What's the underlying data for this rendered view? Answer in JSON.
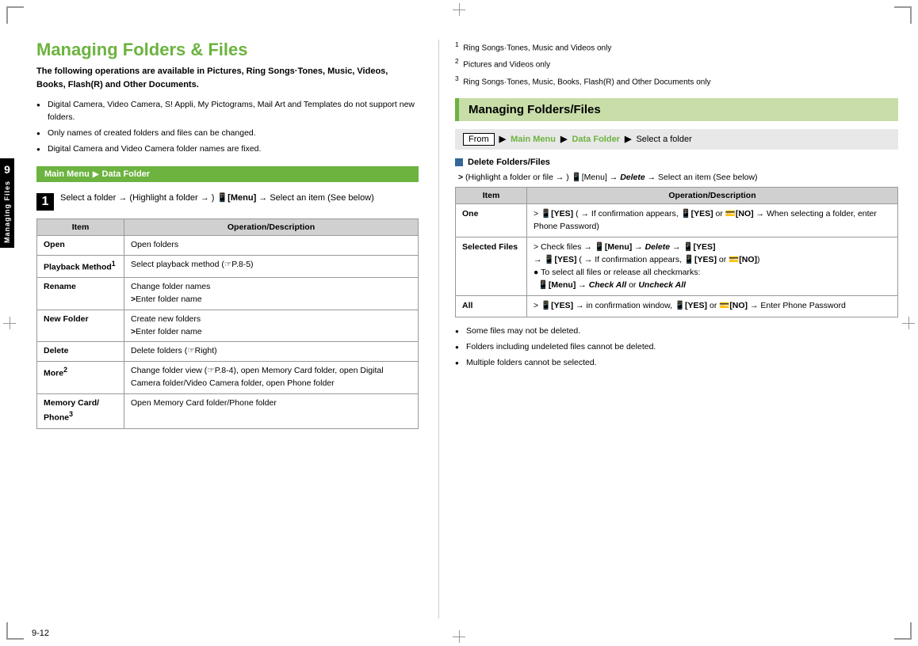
{
  "page": {
    "number": "9-12",
    "chapter_num": "9",
    "chapter_label": "Managing Files"
  },
  "corner_marks": [
    "tl",
    "tr",
    "bl",
    "br"
  ],
  "left": {
    "title": "Managing Folders & Files",
    "intro": "The following operations are available in Pictures, Ring Songs·Tones, Music, Videos, Books, Flash(R) and Other Documents.",
    "bullets": [
      "Digital Camera, Video Camera, S! Appli, My Pictograms, Mail Art and Templates do not support new folders.",
      "Only names of created folders and files can be changed.",
      "Digital Camera and Video Camera folder names are fixed."
    ],
    "nav_bar": {
      "main_menu": "Main Menu",
      "data_folder": "Data Folder"
    },
    "step1": {
      "number": "1",
      "text": "Select a folder → (Highlight a folder → ) [Menu] → Select an item (See below)"
    },
    "table": {
      "headers": [
        "Item",
        "Operation/Description"
      ],
      "rows": [
        {
          "item": "Open",
          "desc": "Open folders"
        },
        {
          "item": "Playback Method¹",
          "desc": "Select playback method (☞P.8-5)"
        },
        {
          "item": "Rename",
          "desc": "Change folder names\n>Enter folder name"
        },
        {
          "item": "New Folder",
          "desc": "Create new folders\n>Enter folder name"
        },
        {
          "item": "Delete",
          "desc": "Delete folders (☞Right)"
        },
        {
          "item": "More²",
          "desc": "Change folder view (☞P.8-4), open Memory Card folder, open Digital Camera folder/Video Camera folder, open Phone folder"
        },
        {
          "item": "Memory Card/Phone³",
          "desc": "Open Memory Card folder/Phone folder"
        }
      ]
    }
  },
  "right": {
    "footnotes": [
      "¹  Ring Songs·Tones, Music and Videos only",
      "²  Pictures and Videos only",
      "³  Ring Songs·Tones, Music, Books, Flash(R) and Other Documents only"
    ],
    "section_title": "Managing Folders/Files",
    "from_label": "From",
    "nav": {
      "main_menu": "Main Menu",
      "data_folder": "Data Folder",
      "select": "Select a folder"
    },
    "delete_section": {
      "title": "Delete Folders/Files",
      "step": "(Highlight a folder or file → ) [Menu] → Delete → Select an item (See below)",
      "table": {
        "headers": [
          "Item",
          "Operation/Description"
        ],
        "rows": [
          {
            "item": "One",
            "desc": "> [YES] ( → If confirmation appears, [YES] or [NO] → When selecting a folder, enter Phone Password)"
          },
          {
            "item": "Selected Files",
            "desc": "> Check files → [Menu] → Delete → [YES]\n→ [YES] ( → If confirmation appears, [YES] or [NO])\n● To select all files or release all checkmarks:\n[Menu] → Check All or Uncheck All"
          },
          {
            "item": "All",
            "desc": "> [YES] → in confirmation window, [YES] or [NO] → Enter Phone Password"
          }
        ]
      },
      "bullets": [
        "Some files may not be deleted.",
        "Folders including undeleted files cannot be deleted.",
        "Multiple folders cannot be selected."
      ]
    }
  }
}
